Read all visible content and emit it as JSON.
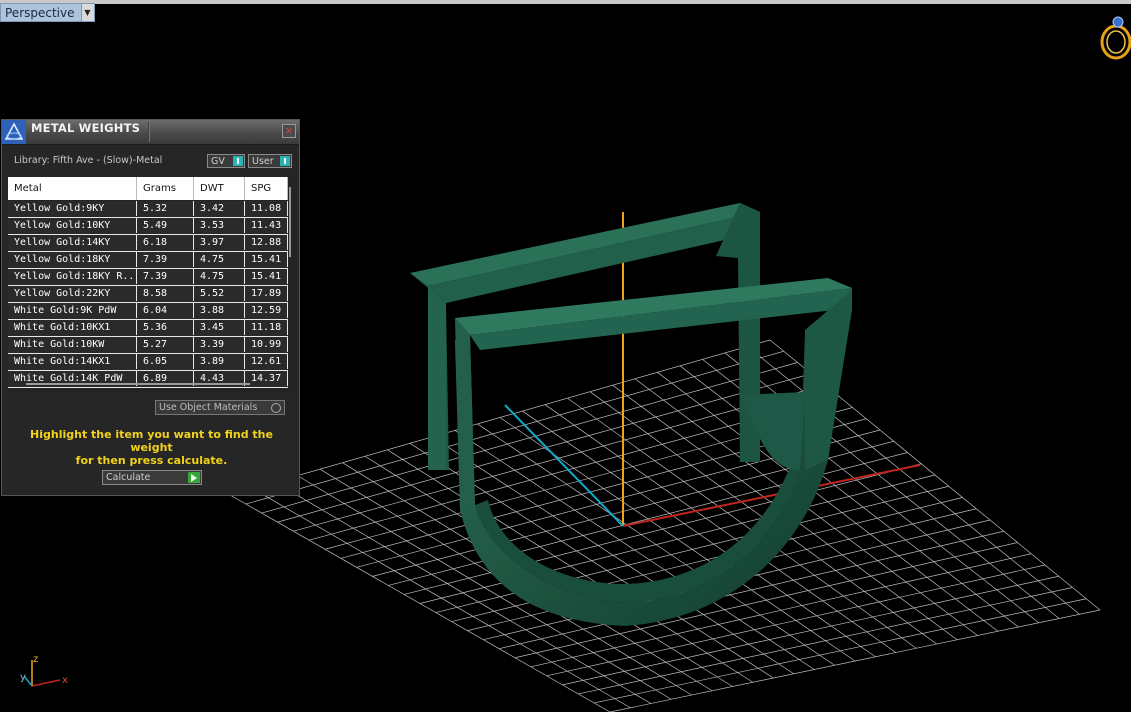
{
  "viewport": {
    "view_name": "Perspective",
    "axis_labels": {
      "x": "x",
      "z": "z",
      "y": "y"
    },
    "colors": {
      "background": "#000000",
      "grid": "#bdbdbd",
      "model": "#1f5b45",
      "x_axis": "#c0261e",
      "y_axis": "#14a9c9",
      "z_axis": "#f0a21a"
    },
    "corner_icon": "ring-icon"
  },
  "panel": {
    "title": "METAL WEIGHTS",
    "logo_icon": "app-logo-icon",
    "close_icon": "close-icon",
    "library_label": "Library: Fifth Ave - (Slow)-Metal",
    "toggle_gv": "GV",
    "toggle_user": "User",
    "table": {
      "headers": [
        "Metal",
        "Grams",
        "DWT",
        "SPG"
      ],
      "rows": [
        [
          "Yellow Gold:9KY",
          "5.32",
          "3.42",
          "11.08"
        ],
        [
          "Yellow Gold:10KY",
          "5.49",
          "3.53",
          "11.43"
        ],
        [
          "Yellow Gold:14KY",
          "6.18",
          "3.97",
          "12.88"
        ],
        [
          "Yellow Gold:18KY",
          "7.39",
          "4.75",
          "15.41"
        ],
        [
          "Yellow Gold:18KY R...",
          "7.39",
          "4.75",
          "15.41"
        ],
        [
          "Yellow Gold:22KY",
          "8.58",
          "5.52",
          "17.89"
        ],
        [
          "White Gold:9K PdW",
          "6.04",
          "3.88",
          "12.59"
        ],
        [
          "White Gold:10KX1",
          "5.36",
          "3.45",
          "11.18"
        ],
        [
          "White Gold:10KW",
          "5.27",
          "3.39",
          "10.99"
        ],
        [
          "White Gold:14KX1",
          "6.05",
          "3.89",
          "12.61"
        ],
        [
          "White Gold:14K PdW",
          "6.89",
          "4.43",
          "14.37"
        ]
      ]
    },
    "use_object_materials": "Use Object Materials",
    "hint_line1": "Highlight the item you want to find the weight",
    "hint_line2": "for then press calculate.",
    "calculate": "Calculate",
    "accent_color": "#f2d21c"
  }
}
